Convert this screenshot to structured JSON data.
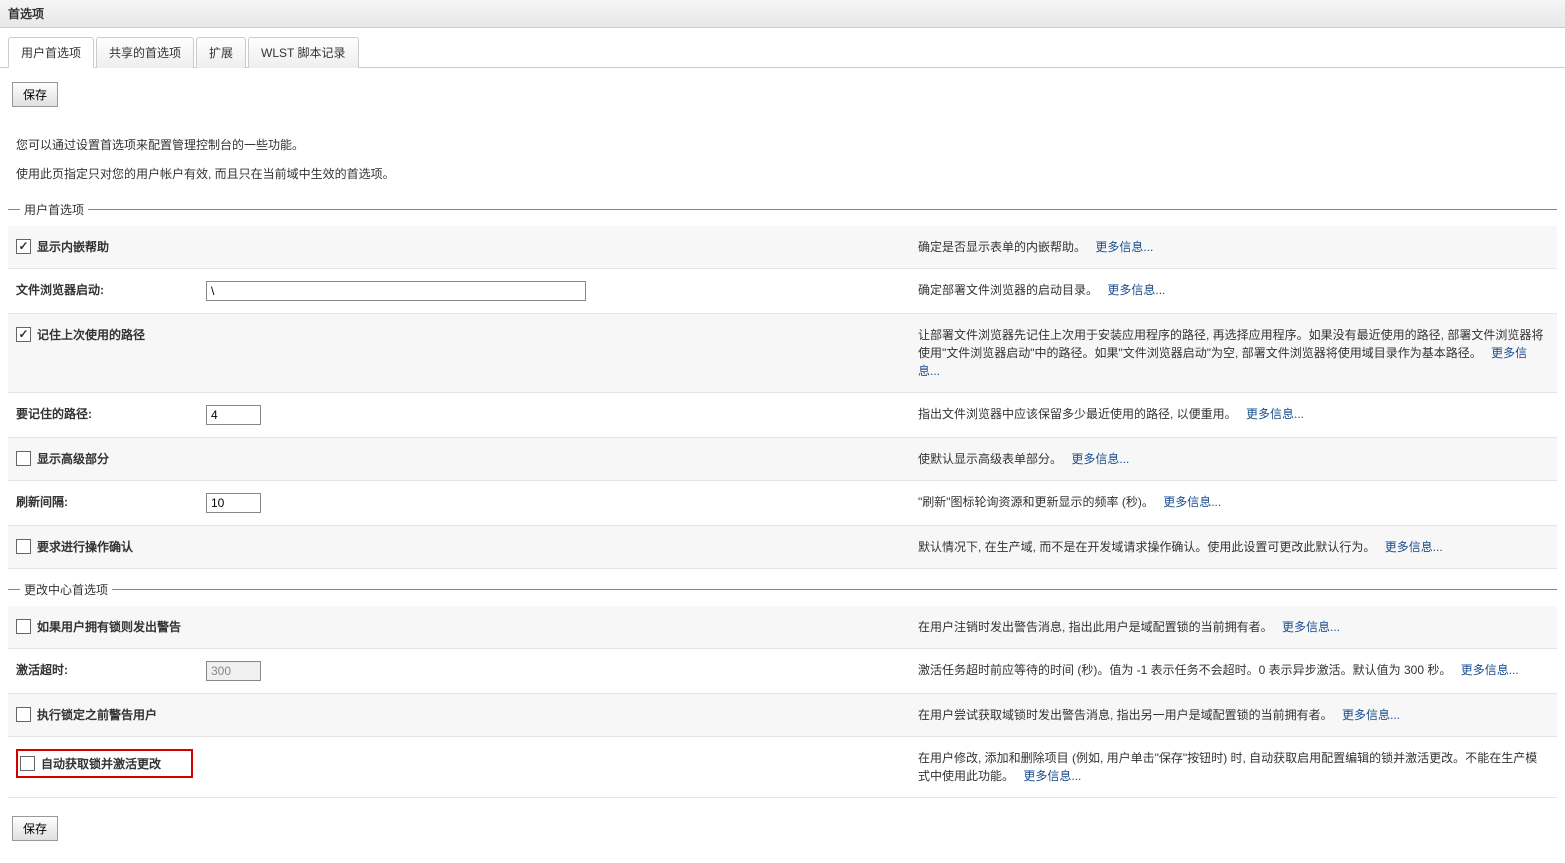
{
  "header": {
    "title": "首选项"
  },
  "tabs": {
    "items": [
      {
        "label": "用户首选项",
        "active": true
      },
      {
        "label": "共享的首选项",
        "active": false
      },
      {
        "label": "扩展",
        "active": false
      },
      {
        "label": "WLST 脚本记录",
        "active": false
      }
    ]
  },
  "buttons": {
    "save": "保存"
  },
  "intro": {
    "line1": "您可以通过设置首选项来配置管理控制台的一些功能。",
    "line2": "使用此页指定只对您的用户帐户有效, 而且只在当前域中生效的首选项。"
  },
  "section1": {
    "legend": "用户首选项",
    "rows": {
      "showInlineHelp": {
        "label": "显示内嵌帮助",
        "desc": "确定是否显示表单的内嵌帮助。"
      },
      "fileBrowserStart": {
        "label": "文件浏览器启动:",
        "value": "\\",
        "desc": "确定部署文件浏览器的启动目录。"
      },
      "rememberPath": {
        "label": "记住上次使用的路径",
        "desc": "让部署文件浏览器先记住上次用于安装应用程序的路径, 再选择应用程序。如果没有最近使用的路径, 部署文件浏览器将使用\"文件浏览器启动\"中的路径。如果\"文件浏览器启动\"为空, 部署文件浏览器将使用域目录作为基本路径。"
      },
      "pathsToRemember": {
        "label": "要记住的路径:",
        "value": "4",
        "desc": "指出文件浏览器中应该保留多少最近使用的路径, 以便重用。"
      },
      "showAdvanced": {
        "label": "显示高级部分",
        "desc": "使默认显示高级表单部分。"
      },
      "refreshInterval": {
        "label": "刷新间隔:",
        "value": "10",
        "desc": "\"刷新\"图标轮询资源和更新显示的频率 (秒)。"
      },
      "askConfirmation": {
        "label": "要求进行操作确认",
        "desc": "默认情况下, 在生产域, 而不是在开发域请求操作确认。使用此设置可更改此默认行为。"
      }
    }
  },
  "section2": {
    "legend": "更改中心首选项",
    "rows": {
      "warnIfLock": {
        "label": "如果用户拥有锁则发出警告",
        "desc": "在用户注销时发出警告消息, 指出此用户是域配置锁的当前拥有者。"
      },
      "activateTimeout": {
        "label": "激活超时:",
        "value": "300",
        "desc": "激活任务超时前应等待的时间 (秒)。值为 -1 表示任务不会超时。0 表示异步激活。默认值为 300 秒。"
      },
      "warnBeforeLock": {
        "label": "执行锁定之前警告用户",
        "desc": "在用户尝试获取域锁时发出警告消息, 指出另一用户是域配置锁的当前拥有者。"
      },
      "autoLockActivate": {
        "label": "自动获取锁并激活更改",
        "desc": "在用户修改, 添加和删除项目 (例如, 用户单击\"保存\"按钮时) 时, 自动获取启用配置编辑的锁并激活更改。不能在生产模式中使用此功能。"
      }
    }
  },
  "links": {
    "more": "更多信息..."
  }
}
